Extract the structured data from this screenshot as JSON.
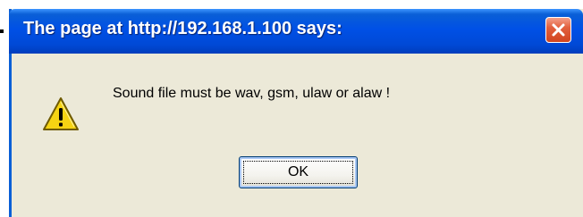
{
  "dialog": {
    "title": "The page at http://192.168.1.100 says:",
    "message": "Sound file must be wav, gsm, ulaw or alaw !",
    "ok_label": "OK",
    "icon": "warning-icon",
    "close_icon": "close-icon"
  },
  "colors": {
    "titlebar": "#0050e6",
    "body": "#ece9d8",
    "close_button": "#d2451f",
    "warning_fill": "#f5d313"
  }
}
